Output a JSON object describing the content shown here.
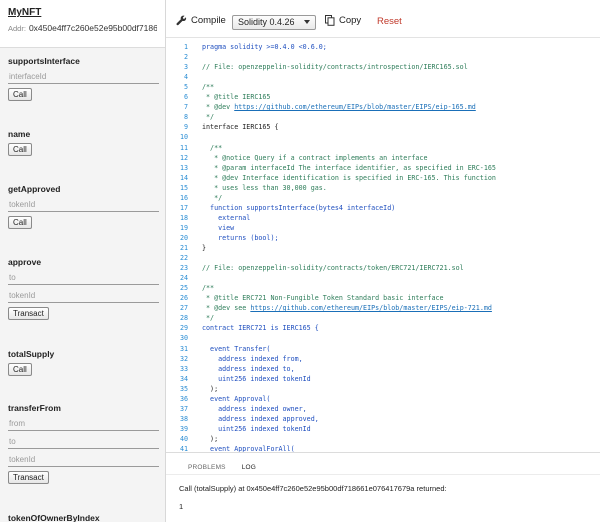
{
  "contract": {
    "name": "MyNFT",
    "address_label": "Addr:",
    "address": "0x450e4ff7c260e52e95b00df7186..."
  },
  "functions": [
    {
      "name": "supportsInterface",
      "inputs": [
        "interfaceId"
      ],
      "button": "Call"
    },
    {
      "name": "name",
      "inputs": [],
      "button": "Call"
    },
    {
      "name": "getApproved",
      "inputs": [
        "tokenId"
      ],
      "button": "Call"
    },
    {
      "name": "approve",
      "inputs": [
        "to",
        "tokenId"
      ],
      "button": "Transact"
    },
    {
      "name": "totalSupply",
      "inputs": [],
      "button": "Call"
    },
    {
      "name": "transferFrom",
      "inputs": [
        "from",
        "to",
        "tokenId"
      ],
      "button": "Transact"
    },
    {
      "name": "tokenOfOwnerByIndex",
      "inputs": [],
      "button": ""
    }
  ],
  "toolbar": {
    "compile_label": "Compile",
    "compiler_version": "Solidity 0.4.26",
    "copy_label": "Copy",
    "reset_label": "Reset"
  },
  "editor": {
    "lines": [
      {
        "n": "1",
        "t": "pragma solidity >=0.4.0 <0.6.0;",
        "k": "kw"
      },
      {
        "n": "2",
        "t": "",
        "k": "plain"
      },
      {
        "n": "3",
        "t": "// File: openzeppelin-solidity/contracts/introspection/IERC165.sol",
        "k": "comment"
      },
      {
        "n": "4",
        "t": "",
        "k": "plain"
      },
      {
        "n": "5",
        "t": "/**",
        "k": "comment"
      },
      {
        "n": "6",
        "t": " * @title IERC165",
        "k": "comment"
      },
      {
        "n": "7",
        "t": " * @dev https://github.com/ethereum/EIPs/blob/master/EIPS/eip-165.md",
        "k": "link"
      },
      {
        "n": "8",
        "t": " */",
        "k": "comment"
      },
      {
        "n": "9",
        "t": "interface IERC165 {",
        "k": "plain"
      },
      {
        "n": "10",
        "t": "",
        "k": "plain"
      },
      {
        "n": "11",
        "t": "  /**",
        "k": "comment"
      },
      {
        "n": "12",
        "t": "   * @notice Query if a contract implements an interface",
        "k": "comment"
      },
      {
        "n": "13",
        "t": "   * @param interfaceId The interface identifier, as specified in ERC-165",
        "k": "comment"
      },
      {
        "n": "14",
        "t": "   * @dev Interface identification is specified in ERC-165. This function",
        "k": "comment"
      },
      {
        "n": "15",
        "t": "   * uses less than 30,000 gas.",
        "k": "comment"
      },
      {
        "n": "16",
        "t": "   */",
        "k": "comment"
      },
      {
        "n": "17",
        "t": "  function supportsInterface(bytes4 interfaceId)",
        "k": "kw"
      },
      {
        "n": "18",
        "t": "    external",
        "k": "kw"
      },
      {
        "n": "19",
        "t": "    view",
        "k": "kw"
      },
      {
        "n": "20",
        "t": "    returns (bool);",
        "k": "kw"
      },
      {
        "n": "21",
        "t": "}",
        "k": "plain"
      },
      {
        "n": "22",
        "t": "",
        "k": "plain"
      },
      {
        "n": "23",
        "t": "// File: openzeppelin-solidity/contracts/token/ERC721/IERC721.sol",
        "k": "comment"
      },
      {
        "n": "24",
        "t": "",
        "k": "plain"
      },
      {
        "n": "25",
        "t": "/**",
        "k": "comment"
      },
      {
        "n": "26",
        "t": " * @title ERC721 Non-Fungible Token Standard basic interface",
        "k": "comment"
      },
      {
        "n": "27",
        "t": " * @dev see https://github.com/ethereum/EIPs/blob/master/EIPS/eip-721.md",
        "k": "link"
      },
      {
        "n": "28",
        "t": " */",
        "k": "comment"
      },
      {
        "n": "29",
        "t": "contract IERC721 is IERC165 {",
        "k": "kw"
      },
      {
        "n": "30",
        "t": "",
        "k": "plain"
      },
      {
        "n": "31",
        "t": "  event Transfer(",
        "k": "kw"
      },
      {
        "n": "32",
        "t": "    address indexed from,",
        "k": "kw"
      },
      {
        "n": "33",
        "t": "    address indexed to,",
        "k": "kw"
      },
      {
        "n": "34",
        "t": "    uint256 indexed tokenId",
        "k": "kw"
      },
      {
        "n": "35",
        "t": "  );",
        "k": "plain"
      },
      {
        "n": "36",
        "t": "  event Approval(",
        "k": "kw"
      },
      {
        "n": "37",
        "t": "    address indexed owner,",
        "k": "kw"
      },
      {
        "n": "38",
        "t": "    address indexed approved,",
        "k": "kw"
      },
      {
        "n": "39",
        "t": "    uint256 indexed tokenId",
        "k": "kw"
      },
      {
        "n": "40",
        "t": "  );",
        "k": "plain"
      },
      {
        "n": "41",
        "t": "  event ApprovalForAll(",
        "k": "kw"
      }
    ]
  },
  "panel": {
    "tabs": [
      {
        "label": "PROBLEMS",
        "active": false
      },
      {
        "label": "LOG",
        "active": true
      }
    ],
    "log_message": "Call (totalSupply) at 0x450e4ff7c260e52e95b00df718661e076417679a returned:",
    "log_result": "1"
  },
  "colors": {
    "reset": "#c0392b",
    "line_number": "#2a8dd4",
    "comment": "#2e7d5a",
    "keyword": "#1f4fbf"
  }
}
